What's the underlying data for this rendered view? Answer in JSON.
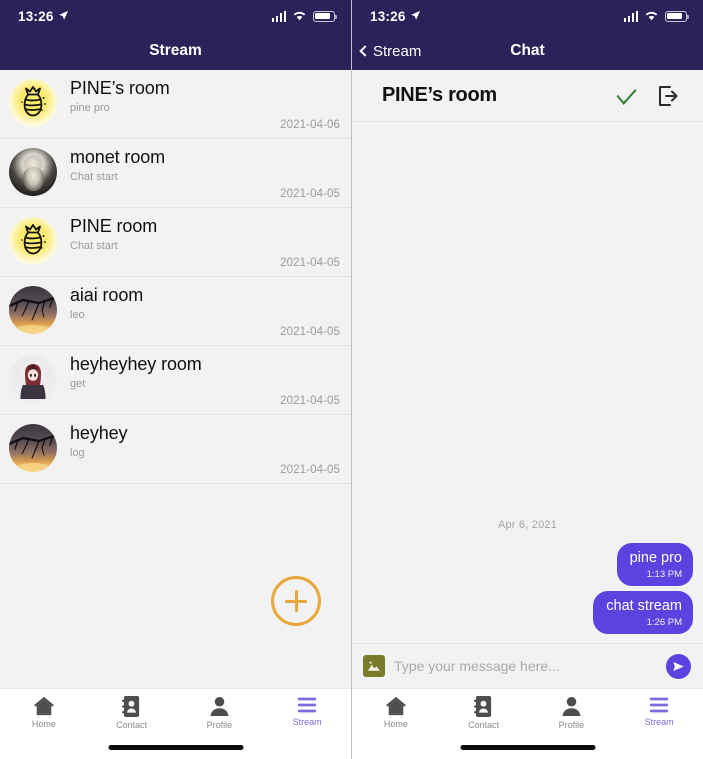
{
  "status_bar": {
    "time": "13:26",
    "location_icon": "location-arrow-icon",
    "cell_icon": "cellular-bars-icon",
    "wifi_icon": "wifi-icon",
    "battery_icon": "battery-icon"
  },
  "left": {
    "navbar": {
      "title": "Stream"
    },
    "rooms": [
      {
        "name": "PINE’s room",
        "subtitle": "pine pro",
        "date": "2021-04-06",
        "avatar": "pineapple-avatar"
      },
      {
        "name": "monet room",
        "subtitle": "Chat start",
        "date": "2021-04-05",
        "avatar": "monet-portrait-avatar"
      },
      {
        "name": "PINE room",
        "subtitle": "Chat start",
        "date": "2021-04-05",
        "avatar": "pineapple-avatar"
      },
      {
        "name": "aiai room",
        "subtitle": "leo",
        "date": "2021-04-05",
        "avatar": "tree-sunset-avatar"
      },
      {
        "name": "heyheyhey room",
        "subtitle": "get",
        "date": "2021-04-05",
        "avatar": "anime-girl-avatar"
      },
      {
        "name": "heyhey",
        "subtitle": "log",
        "date": "2021-04-05",
        "avatar": "tree-sunset-avatar"
      }
    ],
    "fab": {
      "icon": "plus-circle-icon",
      "color": "#e8a83a"
    }
  },
  "right": {
    "navbar": {
      "back_label": "Stream",
      "title": "Chat",
      "back_icon": "chevron-left-icon"
    },
    "chat_header": {
      "title": "PINE’s room",
      "check_icon": "check-icon",
      "check_color": "#2e7d32",
      "exit_icon": "exit-door-icon"
    },
    "day_separator": "Apr 6, 2021",
    "messages": [
      {
        "text": "pine pro",
        "time": "1:13 PM",
        "side": "outgoing"
      },
      {
        "text": "chat stream",
        "time": "1:26 PM",
        "side": "outgoing"
      }
    ],
    "composer": {
      "image_icon": "image-attachment-icon",
      "placeholder": "Type your message here...",
      "value": "",
      "send_icon": "send-icon"
    }
  },
  "tabbar": {
    "items": [
      {
        "label": "Home",
        "icon": "home-icon",
        "active": false
      },
      {
        "label": "Contact",
        "icon": "contact-card-icon",
        "active": false
      },
      {
        "label": "Profile",
        "icon": "person-icon",
        "active": false
      },
      {
        "label": "Stream",
        "icon": "stream-lines-icon",
        "active": true
      }
    ],
    "active_color": "#7b6ce0",
    "inactive_color": "#8a8a8a"
  },
  "theme": {
    "navbar_bg": "#2a2359",
    "bubble": "#5b43e0",
    "bg": "#f2f2f2"
  }
}
